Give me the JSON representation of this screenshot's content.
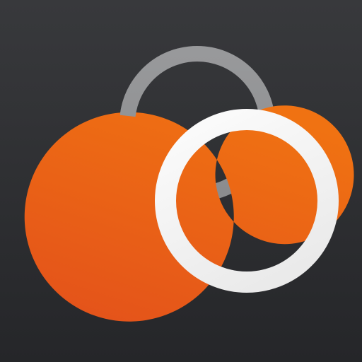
{
  "icon": {
    "name": "interlocking-rings-logo",
    "colors": {
      "background_top": "#38393c",
      "background_bottom": "#252629",
      "orange_light": "#f07212",
      "orange_dark": "#e4531a",
      "gray_ring": "#98999b",
      "gray_ring_dark": "#8b8c8e",
      "white_ring_light": "#fafafa",
      "white_ring_dark": "#e9e9e9"
    }
  }
}
